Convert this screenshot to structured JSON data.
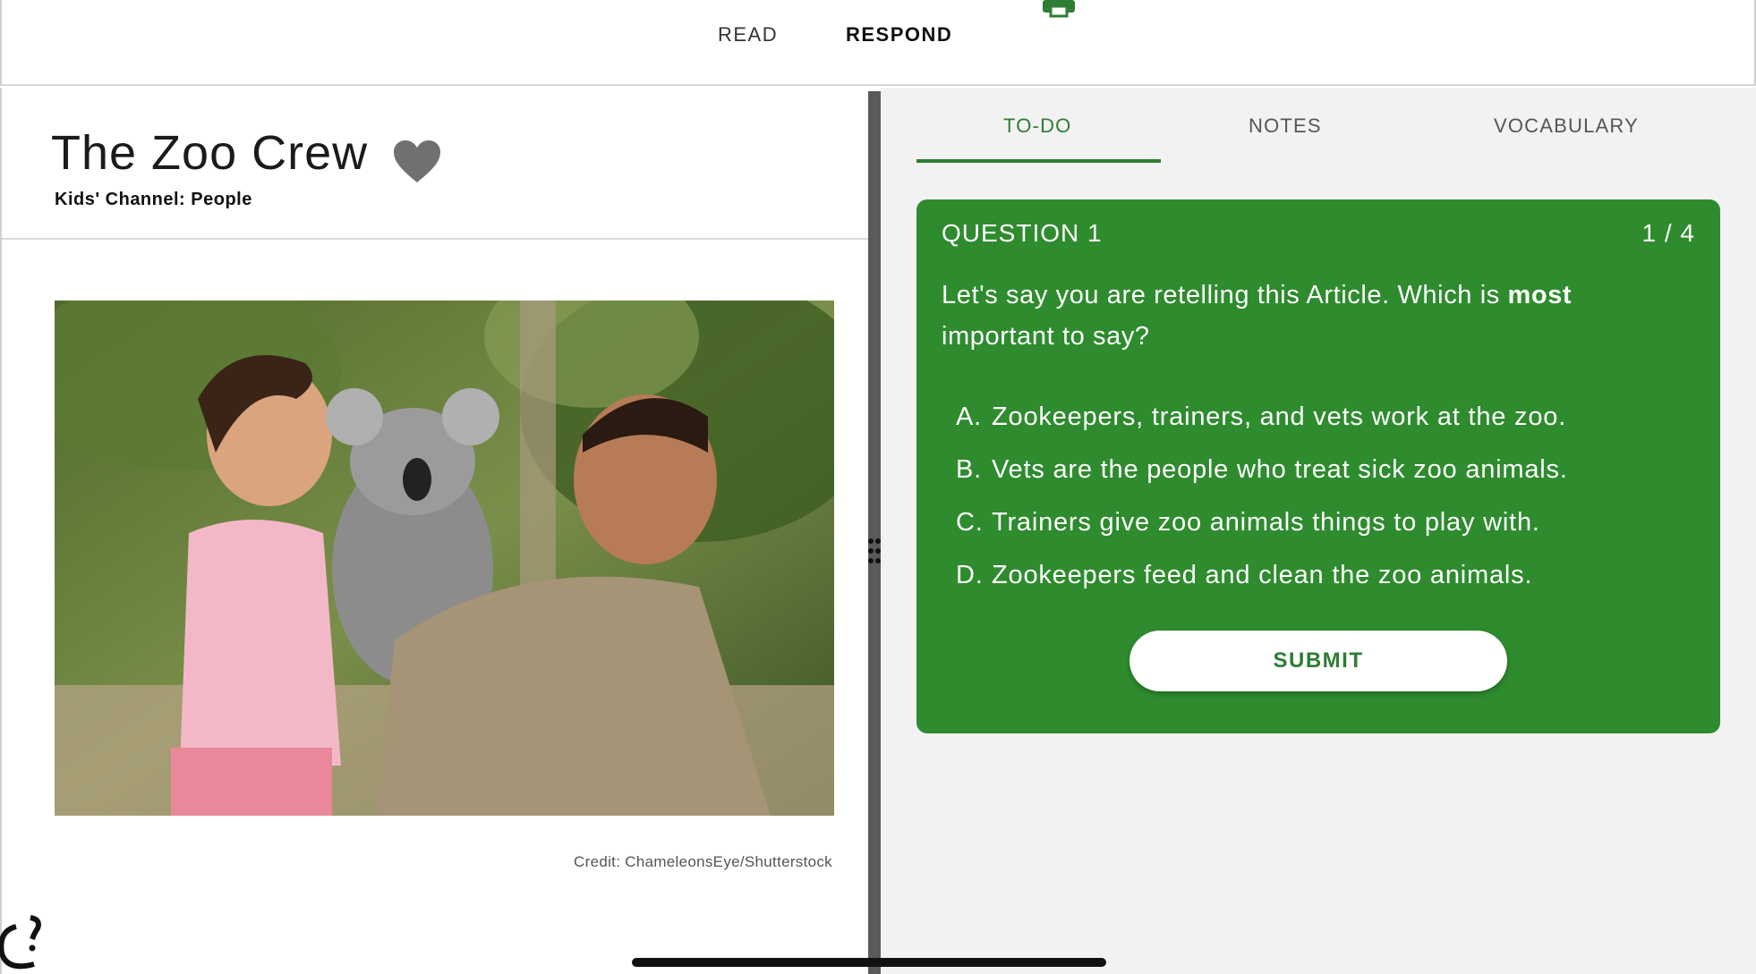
{
  "topbar": {
    "read_label": "READ",
    "respond_label": "RESPOND",
    "print_icon": "print-icon"
  },
  "article": {
    "title": "The Zoo Crew",
    "channel": "Kids' Channel: People",
    "credit": "Credit: ChameleonsEye/Shutterstock"
  },
  "tabs": {
    "todo": "TO-DO",
    "notes": "NOTES",
    "vocabulary": "VOCABULARY"
  },
  "question": {
    "label": "QUESTION 1",
    "count": "1 / 4",
    "text_before": "Let's say you are retelling this Article. Which is ",
    "text_bold": "most",
    "text_after": " important to say?",
    "options": [
      {
        "letter": "A.",
        "text": "Zookeepers, trainers, and vets work at the zoo."
      },
      {
        "letter": "B.",
        "text": "Vets are the people who treat sick zoo animals."
      },
      {
        "letter": "C.",
        "text": "Trainers give zoo animals things to play with."
      },
      {
        "letter": "D.",
        "text": "Zookeepers feed and clean the zoo animals."
      }
    ],
    "submit_label": "SUBMIT"
  },
  "colors": {
    "accent_green": "#2e8b2e",
    "tab_green": "#2e7d32",
    "divider": "#5a5a5a"
  }
}
